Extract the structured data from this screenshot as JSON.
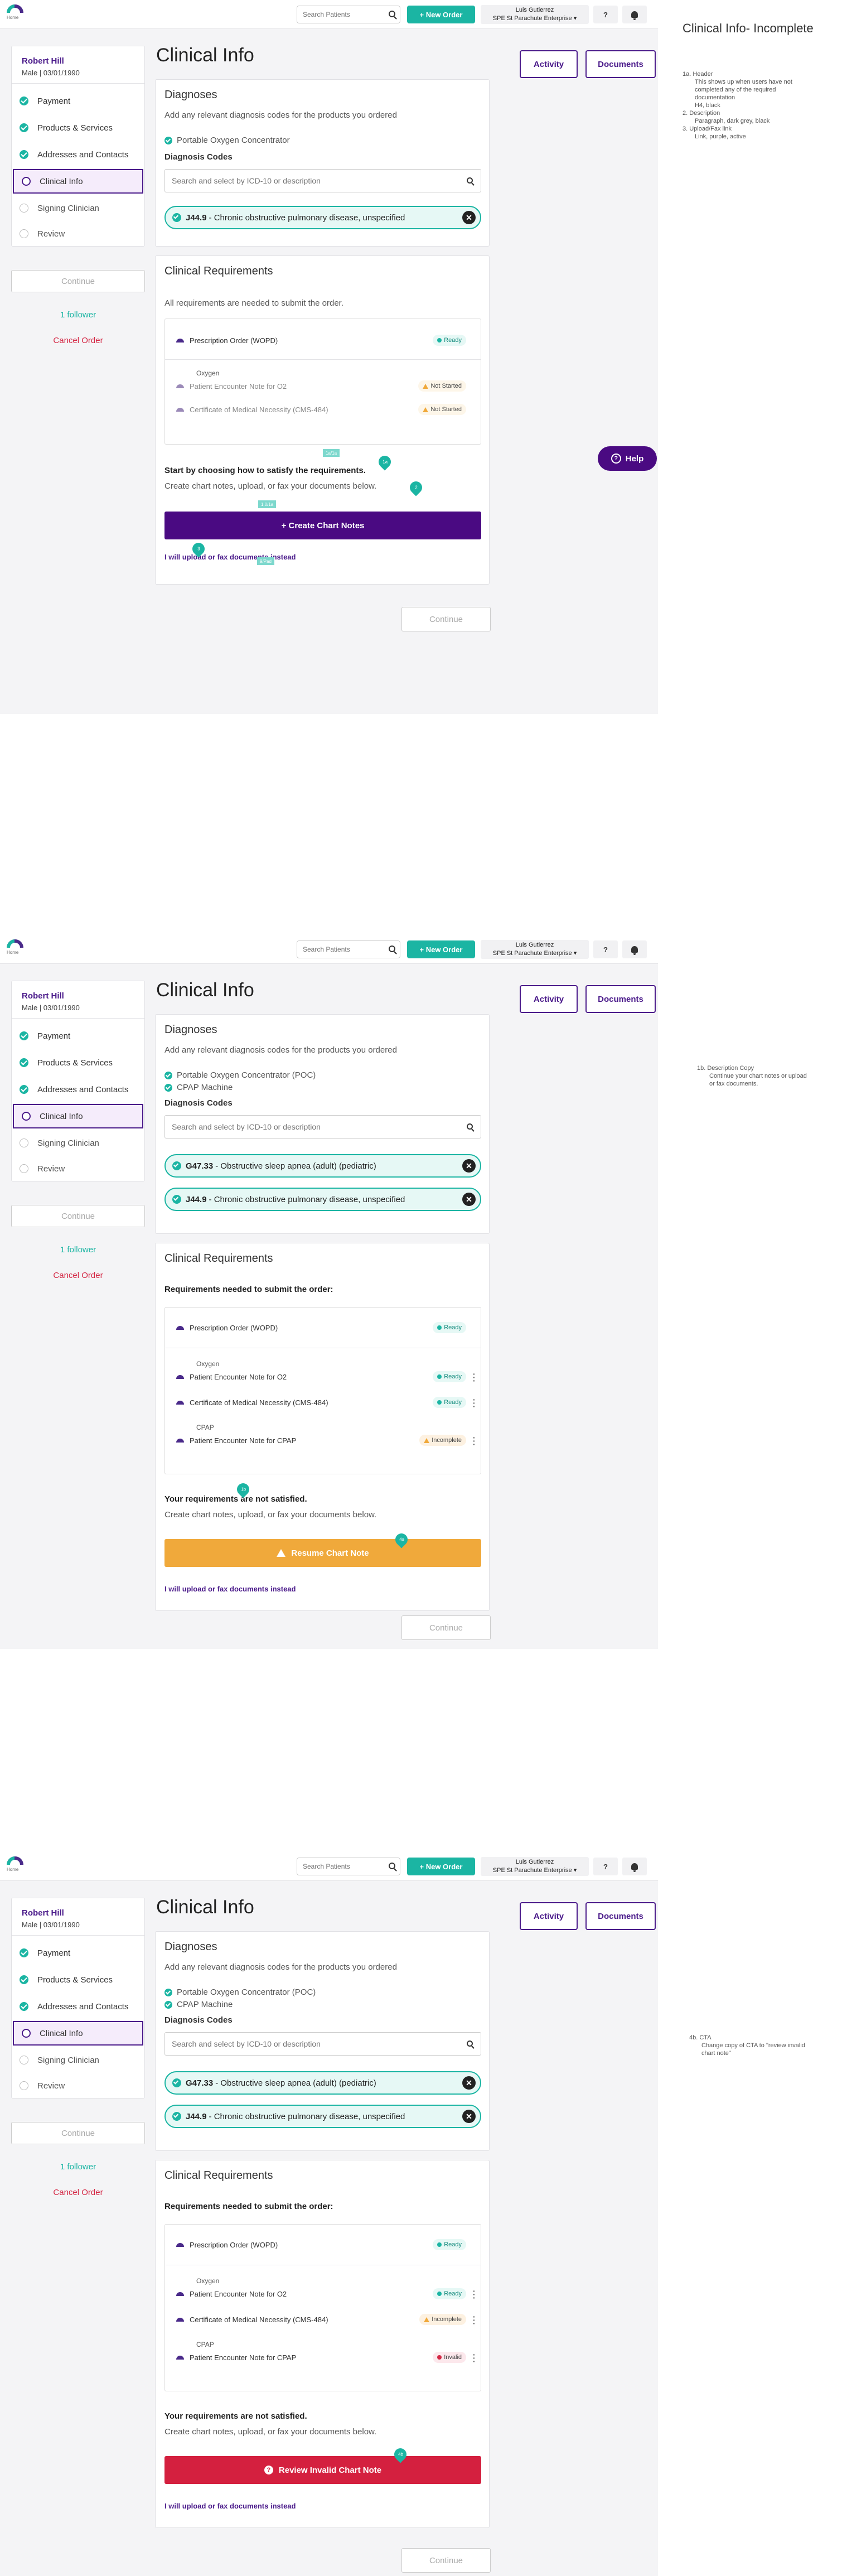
{
  "app": {
    "logo_label": "Home",
    "search_placeholder": "Search Patients",
    "new_order_label": "+ New Order",
    "user_name": "Luis Gutierrez",
    "user_company": "SPE St Parachute Enterprise ▾",
    "help_icon_label": "?",
    "help_button_label": "Help"
  },
  "patient": {
    "name": "Robert Hill",
    "info": "Male | 03/01/1990"
  },
  "steps": [
    "Payment",
    "Products & Services",
    "Addresses and Contacts",
    "Clinical Info",
    "Signing Clinician",
    "Review"
  ],
  "sidebar": {
    "continue_label": "Continue",
    "followers": "1 follower",
    "cancel_label": "Cancel Order"
  },
  "page": {
    "title": "Clinical Info",
    "activity_label": "Activity",
    "documents_label": "Documents",
    "continue_label": "Continue"
  },
  "diagnoses": {
    "title": "Diagnoses",
    "description": "Add any relevant diagnosis codes for the products you ordered",
    "codes_label": "Diagnosis Codes",
    "search_placeholder": "Search and select by ICD-10 or description"
  },
  "clinical": {
    "title": "Clinical Requirements",
    "all_needed_text": "All requirements are needed to submit the order.",
    "needed_text": "Requirements needed to submit the order:",
    "start_heading": "Start by choosing how to satisfy the requirements.",
    "not_satisfied_heading": "Your requirements are not satisfied.",
    "subtext": "Create chart notes, upload, or fax your documents below.",
    "upload_link": "I will upload or fax documents instead"
  },
  "screens": [
    {
      "products": [
        "Portable Oxygen Concentrator"
      ],
      "dx": [
        {
          "code": "J44.9",
          "desc": "- Chronic obstructive pulmonary disease, unspecified"
        }
      ],
      "reqs": {
        "wopd": {
          "label": "Prescription Order (WOPD)",
          "status": "Ready"
        },
        "group1": "Oxygen",
        "r1": {
          "label": "Patient Encounter Note for O2",
          "status": "Not Started"
        },
        "r2": {
          "label": "Certificate of Medical Necessity (CMS-484)",
          "status": "Not Started"
        }
      },
      "cta": "+ Create Chart Notes",
      "annotations": {
        "a1": "1a",
        "a2": "1b",
        "a3": "2",
        "a4": "3",
        "a5": "2a",
        "t1": "1a/1a",
        "t2": "1.0/1a",
        "t3": "9/Pad"
      }
    },
    {
      "products": [
        "Portable Oxygen Concentrator (POC)",
        "CPAP Machine"
      ],
      "dx": [
        {
          "code": "G47.33",
          "desc": "- Obstructive sleep apnea (adult) (pediatric)"
        },
        {
          "code": "J44.9",
          "desc": "- Chronic obstructive pulmonary disease, unspecified"
        }
      ],
      "reqs": {
        "wopd": {
          "label": "Prescription Order (WOPD)",
          "status": "Ready"
        },
        "group1": "Oxygen",
        "r1": {
          "label": "Patient Encounter Note for O2",
          "status": "Ready"
        },
        "r2": {
          "label": "Certificate of Medical Necessity (CMS-484)",
          "status": "Ready"
        },
        "group2": "CPAP",
        "r3": {
          "label": "Patient Encounter Note for CPAP",
          "status": "Incomplete"
        }
      },
      "cta": "Resume Chart Note",
      "annotations": {
        "a1": "1b",
        "a2": "4a"
      }
    },
    {
      "products": [
        "Portable Oxygen Concentrator (POC)",
        "CPAP Machine"
      ],
      "dx": [
        {
          "code": "G47.33",
          "desc": "- Obstructive sleep apnea (adult) (pediatric)"
        },
        {
          "code": "J44.9",
          "desc": "- Chronic obstructive pulmonary disease, unspecified"
        }
      ],
      "reqs": {
        "wopd": {
          "label": "Prescription Order (WOPD)",
          "status": "Ready"
        },
        "group1": "Oxygen",
        "r1": {
          "label": "Patient Encounter Note for O2",
          "status": "Ready"
        },
        "r2": {
          "label": "Certificate of Medical Necessity (CMS-484)",
          "status": "Incomplete"
        },
        "group2": "CPAP",
        "r3": {
          "label": "Patient Encounter Note for CPAP",
          "status": "Invalid"
        }
      },
      "cta": "Review Invalid Chart Note",
      "annotations": {
        "a1": "4b"
      }
    }
  ],
  "notes": {
    "title": "Clinical Info- Incomplete",
    "n1_1": "1a. Header",
    "n1_2": "This shows up when users have not completed any of the required documentation",
    "n1_3": "H4, black",
    "n1_4": "2. Description",
    "n1_5": "Paragraph, dark grey, black",
    "n1_6": "3. Upload/Fax link",
    "n1_7": "Link, purple, active",
    "n2_1": "1b. Description Copy",
    "n2_2": "Continue your chart notes or upload or fax documents.",
    "n3_1": "4b. CTA",
    "n3_2": "Change copy of CTA to \"review invalid chart note\""
  },
  "colors": {
    "brand_purple": "#4a0a82",
    "accent_teal": "#1bb5a3",
    "danger_red": "#d4203f",
    "warning_orange": "#f0a93b"
  }
}
